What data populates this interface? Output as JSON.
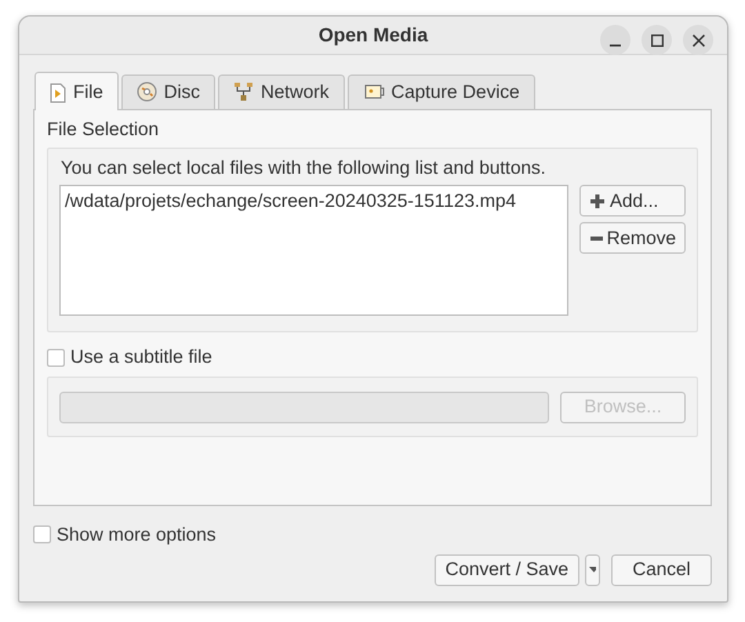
{
  "window": {
    "title": "Open Media"
  },
  "tabs": [
    {
      "label": "File",
      "selected": true
    },
    {
      "label": "Disc",
      "selected": false
    },
    {
      "label": "Network",
      "selected": false
    },
    {
      "label": "Capture Device",
      "selected": false
    }
  ],
  "file_selection": {
    "title": "File Selection",
    "hint": "You can select local files with the following list and buttons.",
    "files": [
      "/wdata/projets/echange/screen-20240325-151123.mp4"
    ],
    "buttons": [
      {
        "label": "Add..."
      },
      {
        "label": "Remove"
      }
    ]
  },
  "subtitle": {
    "label": "Use a subtitle file",
    "checked": false,
    "browse": {
      "label": "Browse...",
      "disabled": true
    }
  },
  "show_more": {
    "label": "Show more options",
    "checked": false
  },
  "footer": {
    "primary": "Convert / Save",
    "cancel": "Cancel"
  }
}
